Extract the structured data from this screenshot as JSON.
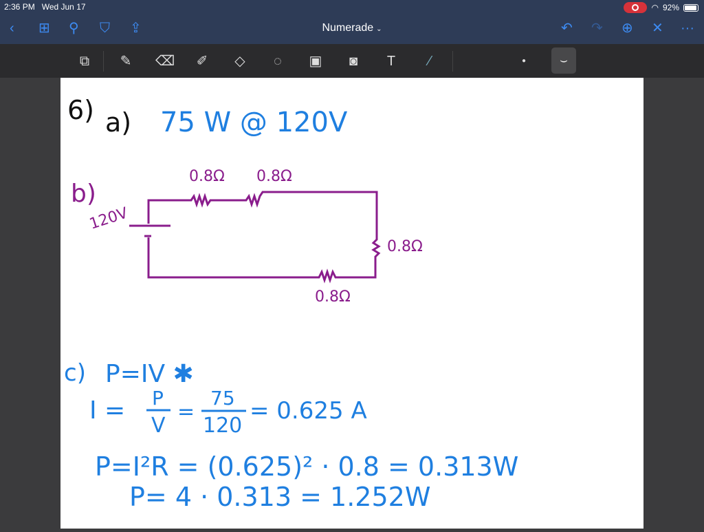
{
  "status_bar": {
    "time": "2:36 PM",
    "date": "Wed Jun 17",
    "battery": "92%",
    "battery_level": 0.92
  },
  "nav": {
    "title": "Numerade",
    "icons": [
      "back-icon",
      "grid-icon",
      "search-icon",
      "bookmark-icon",
      "share-icon",
      "undo-icon",
      "redo-icon",
      "add-page-icon",
      "close-icon",
      "more-icon"
    ]
  },
  "toolbar": {
    "tools": [
      "zoom-window",
      "pen",
      "eraser",
      "highlighter",
      "shapes",
      "lasso",
      "image",
      "camera",
      "text",
      "laser-pointer"
    ]
  },
  "notes": {
    "l1a": "6)",
    "l1b": "a)",
    "l1c": "75 W @ 120V",
    "b": "b)",
    "v": "120V",
    "r1": "0.8Ω",
    "r2": "0.8Ω",
    "r3": "0.8Ω",
    "r4": "0.8Ω",
    "c": "c)",
    "c1": "P=IV ✱",
    "c2a": "I =",
    "c2p": "P",
    "c2v": "V",
    "c2eq": "=",
    "c2n": "75",
    "c2d": "120",
    "c2r": "= 0.625 A",
    "c3": "P=I²R = (0.625)² · 0.8 = 0.313W",
    "c4": "P= 4 · 0.313 = 1.252W"
  }
}
